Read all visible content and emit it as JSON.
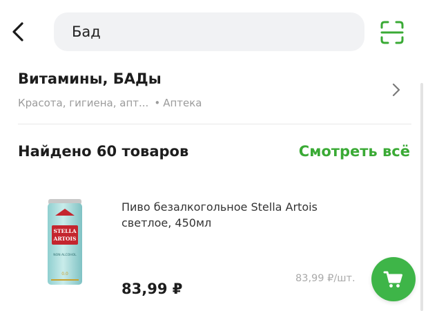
{
  "header": {
    "back_icon": "chevron-left-icon",
    "search_value": "Бад",
    "scan_icon": "barcode-scan-icon"
  },
  "category": {
    "title": "Витамины, БАДы",
    "subtitle": "Красота, гигиена, апт...",
    "separator": "•",
    "section": "Аптека",
    "chevron_icon": "chevron-right-icon"
  },
  "results": {
    "found_label": "Найдено 60 товаров",
    "see_all_label": "Смотреть всё"
  },
  "product": {
    "name": "Пиво безалкогольное Stella Artois светлое, 450мл",
    "price": "83,99 ₽",
    "unit_price": "83,99 ₽/шт.",
    "can_brand_line1": "STELLA",
    "can_brand_line2": "ARTOIS",
    "can_tag": "NON ALCOHOL",
    "can_abv": "0.0",
    "cart_icon": "cart-icon"
  },
  "colors": {
    "accent": "#3aaa35",
    "cart_button": "#3eb548",
    "search_bg": "#f1f2f4",
    "muted_text": "#9b9b9b"
  }
}
